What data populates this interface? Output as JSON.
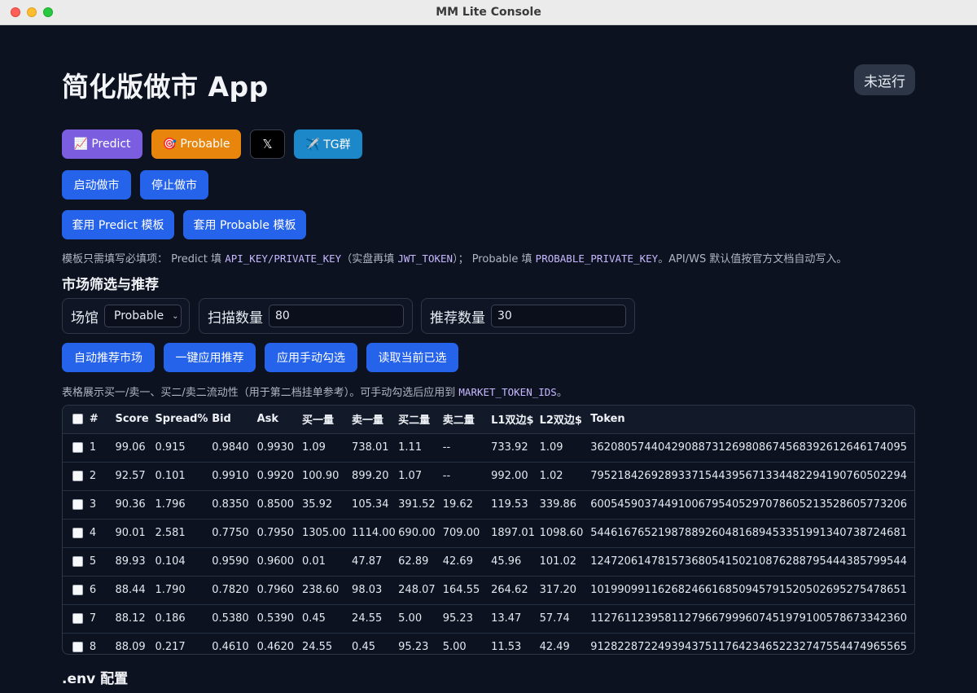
{
  "window": {
    "title": "MM Lite Console"
  },
  "header": {
    "title": "简化版做市 App",
    "status": "未运行"
  },
  "links": {
    "predict": "📈 Predict",
    "probable": "🎯 Probable",
    "x": "𝕏",
    "tg": "✈️ TG群"
  },
  "controls": {
    "start": "启动做市",
    "stop": "停止做市"
  },
  "templates": {
    "predict": "套用 Predict 模板",
    "probable": "套用 Probable 模板"
  },
  "template_hint": {
    "p1": "模板只需填写必填项： Predict 填 ",
    "c1": "API_KEY/PRIVATE_KEY",
    "p2": "（实盘再填 ",
    "c2": "JWT_TOKEN",
    "p3": "）； Probable 填 ",
    "c3": "PROBABLE_PRIVATE_KEY",
    "p4": "。API/WS 默认值按官方文档自动写入。"
  },
  "market": {
    "section_title": "市场筛选与推荐",
    "venue_label": "场馆",
    "venue_value": "Probable",
    "scan_label": "扫描数量",
    "scan_value": "80",
    "recommend_label": "推荐数量",
    "recommend_value": "30",
    "buttons": {
      "auto": "自动推荐市场",
      "apply_rec": "一键应用推荐",
      "apply_manual": "应用手动勾选",
      "read": "读取当前已选"
    },
    "hint_text": "表格展示买一/卖一、买二/卖二流动性（用于第二档挂单参考）。可手动勾选后应用到 ",
    "hint_code": "MARKET_TOKEN_IDS",
    "hint_end": "。"
  },
  "table": {
    "headers": [
      "#",
      "Score",
      "Spread%",
      "Bid",
      "Ask",
      "买一量",
      "卖一量",
      "买二量",
      "卖二量",
      "L1双边$",
      "L2双边$",
      "Token"
    ],
    "rows": [
      [
        "1",
        "99.06",
        "0.915",
        "0.9840",
        "0.9930",
        "1.09",
        "738.01",
        "1.11",
        "--",
        "733.92",
        "1.09",
        "36208057440429088731269808674568392612646174095"
      ],
      [
        "2",
        "92.57",
        "0.101",
        "0.9910",
        "0.9920",
        "100.90",
        "899.20",
        "1.07",
        "--",
        "992.00",
        "1.02",
        "79521842692893371544395671334482294190760502294"
      ],
      [
        "3",
        "90.36",
        "1.796",
        "0.8350",
        "0.8500",
        "35.92",
        "105.34",
        "391.52",
        "19.62",
        "119.53",
        "339.86",
        "60054590374491006795405297078605213528605773206"
      ],
      [
        "4",
        "90.01",
        "2.581",
        "0.7750",
        "0.7950",
        "1305.00",
        "1114.00",
        "690.00",
        "709.00",
        "1897.01",
        "1098.60",
        "54461676521987889260481689453351991340738724681"
      ],
      [
        "5",
        "89.93",
        "0.104",
        "0.9590",
        "0.9600",
        "0.01",
        "47.87",
        "62.89",
        "42.69",
        "45.96",
        "101.02",
        "12472061478157368054150210876288795444385799544"
      ],
      [
        "6",
        "88.44",
        "1.790",
        "0.7820",
        "0.7960",
        "238.60",
        "98.03",
        "248.07",
        "164.55",
        "264.62",
        "317.20",
        "10199099116268246616850945791520502695275478651"
      ],
      [
        "7",
        "88.12",
        "0.186",
        "0.5380",
        "0.5390",
        "0.45",
        "24.55",
        "5.00",
        "95.23",
        "13.47",
        "57.74",
        "11276112395811279667999607451979100578673342360"
      ],
      [
        "8",
        "88.09",
        "0.217",
        "0.4610",
        "0.4620",
        "24.55",
        "0.45",
        "95.23",
        "5.00",
        "11.53",
        "42.49",
        "91282287224939437511764234652232747554474965565"
      ]
    ]
  },
  "env": {
    "title": ".env 配置"
  }
}
